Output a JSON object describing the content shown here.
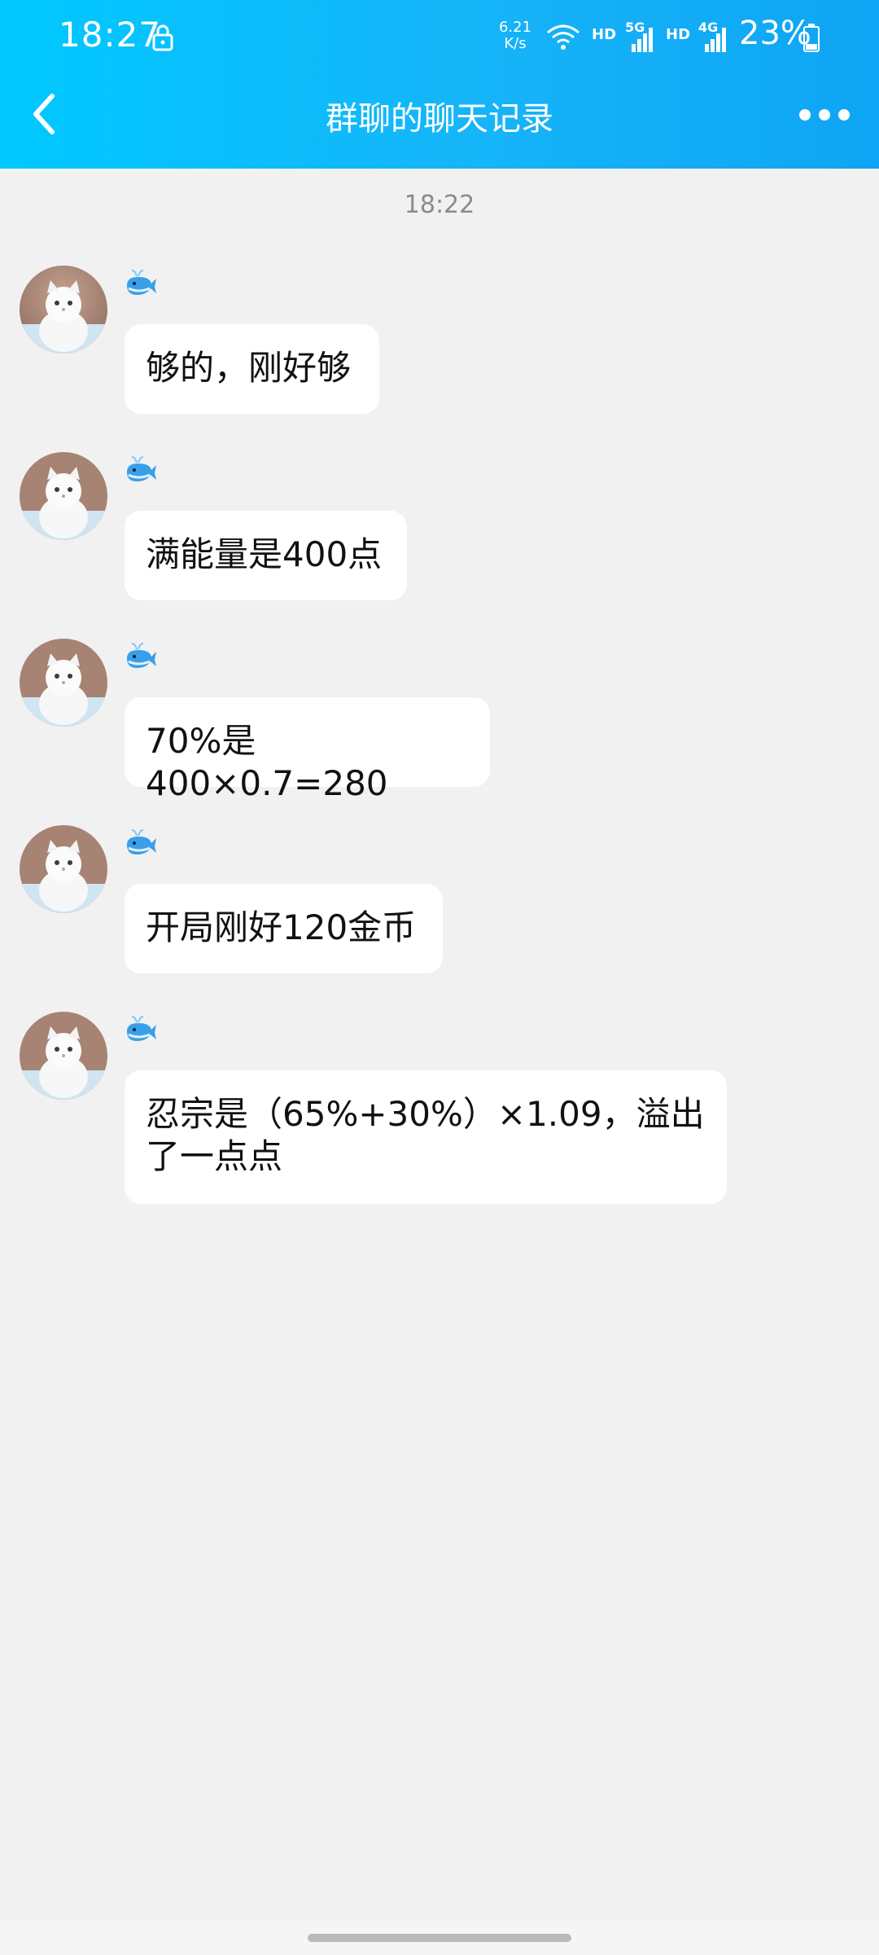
{
  "status_bar": {
    "time": "18:27",
    "net_speed_value": "6.21",
    "net_speed_unit": "K/s",
    "hd1": "HD",
    "net1": "5G",
    "hd2": "HD",
    "net2": "4G",
    "battery": "23%"
  },
  "header": {
    "title": "群聊的聊天记录",
    "back_icon": "chevron-left-icon",
    "more_icon": "more-dots-icon"
  },
  "chat": {
    "timestamp": "18:22",
    "messages": [
      {
        "text": "够的，刚好够"
      },
      {
        "text": "满能量是400点"
      },
      {
        "text": "70%是400×0.7=280"
      },
      {
        "text": "开局刚好120金币"
      },
      {
        "text_line1": "忍宗是（65%+30%）×1.09，溢出",
        "text_line2": "了一点点"
      }
    ]
  },
  "colors": {
    "header_start": "#00c8ff",
    "header_end": "#0ea5f4",
    "background": "#f1f1f1",
    "bubble": "#ffffff"
  }
}
